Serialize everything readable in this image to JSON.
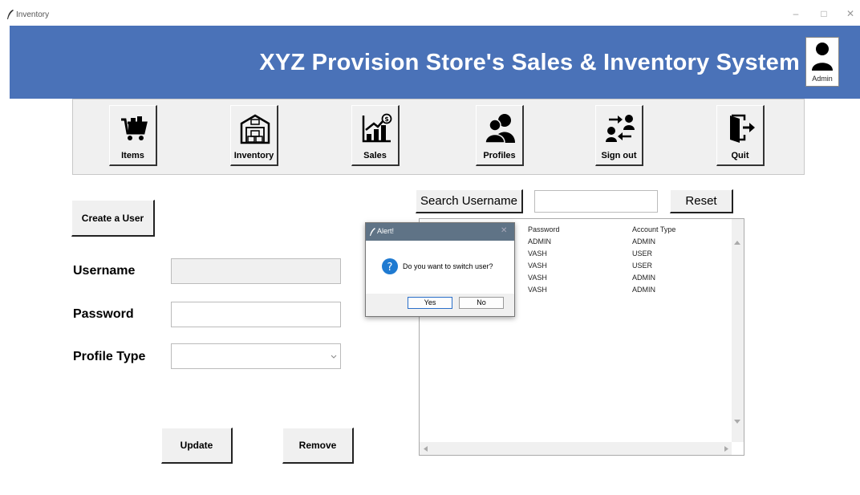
{
  "window": {
    "title": "Inventory",
    "minimize": "–",
    "maximize": "□",
    "close": "✕"
  },
  "header": {
    "title": "XYZ Provision Store's Sales & Inventory System",
    "user_label": "Admin",
    "bg_color": "#4a72b8"
  },
  "nav": {
    "items": [
      {
        "label": "Items",
        "icon": "shopping-cart-icon"
      },
      {
        "label": "Inventory",
        "icon": "warehouse-icon"
      },
      {
        "label": "Sales",
        "icon": "sales-chart-icon"
      },
      {
        "label": "Profiles",
        "icon": "users-icon"
      },
      {
        "label": "Sign out",
        "icon": "switch-user-icon"
      },
      {
        "label": "Quit",
        "icon": "exit-door-icon"
      }
    ]
  },
  "form": {
    "create_button": "Create a User",
    "username_label": "Username",
    "password_label": "Password",
    "profile_type_label": "Profile Type",
    "username_value": "",
    "password_value": "",
    "profile_type_value": "",
    "update_button": "Update",
    "remove_button": "Remove"
  },
  "search": {
    "button": "Search Username",
    "value": "",
    "reset_button": "Reset"
  },
  "table": {
    "columns": [
      "Password",
      "Account Type"
    ],
    "rows": [
      [
        "ADMIN",
        "ADMIN"
      ],
      [
        "VASH",
        "USER"
      ],
      [
        "VASH",
        "USER"
      ],
      [
        "VASH",
        "ADMIN"
      ],
      [
        "VASH",
        "ADMIN"
      ]
    ]
  },
  "dialog": {
    "title": "Alert!",
    "message": "Do you want to switch user?",
    "yes": "Yes",
    "no": "No"
  }
}
